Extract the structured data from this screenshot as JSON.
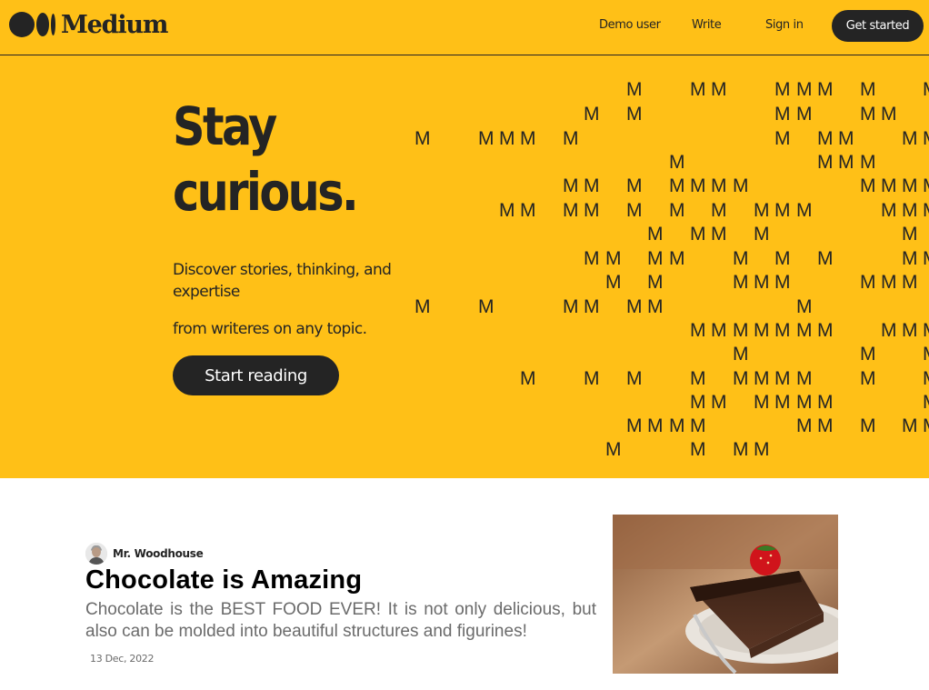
{
  "header": {
    "logo_text": "Medium",
    "nav": {
      "demo_user": "Demo user",
      "write": "Write",
      "sign_in": "Sign in"
    },
    "get_started": "Get started"
  },
  "hero": {
    "title_line1": "Stay",
    "title_line2": "curious.",
    "subtitle_line1": "Discover stories, thinking, and expertise",
    "subtitle_line2": "from writeres on any topic.",
    "cta": "Start reading",
    "pattern_glyph": "M"
  },
  "article": {
    "author": "Mr. Woodhouse",
    "title": "Chocolate is Amazing",
    "excerpt": "Chocolate is the BEST FOOD EVER! It is not only delicious, but also can be molded into beautiful structures and figurines!",
    "date": "13 Dec, 2022",
    "thumbnail_icon": "chocolate-cake-image"
  },
  "colors": {
    "brand_yellow": "#ffc017",
    "ink": "#242424",
    "muted": "#6b6b6b"
  }
}
